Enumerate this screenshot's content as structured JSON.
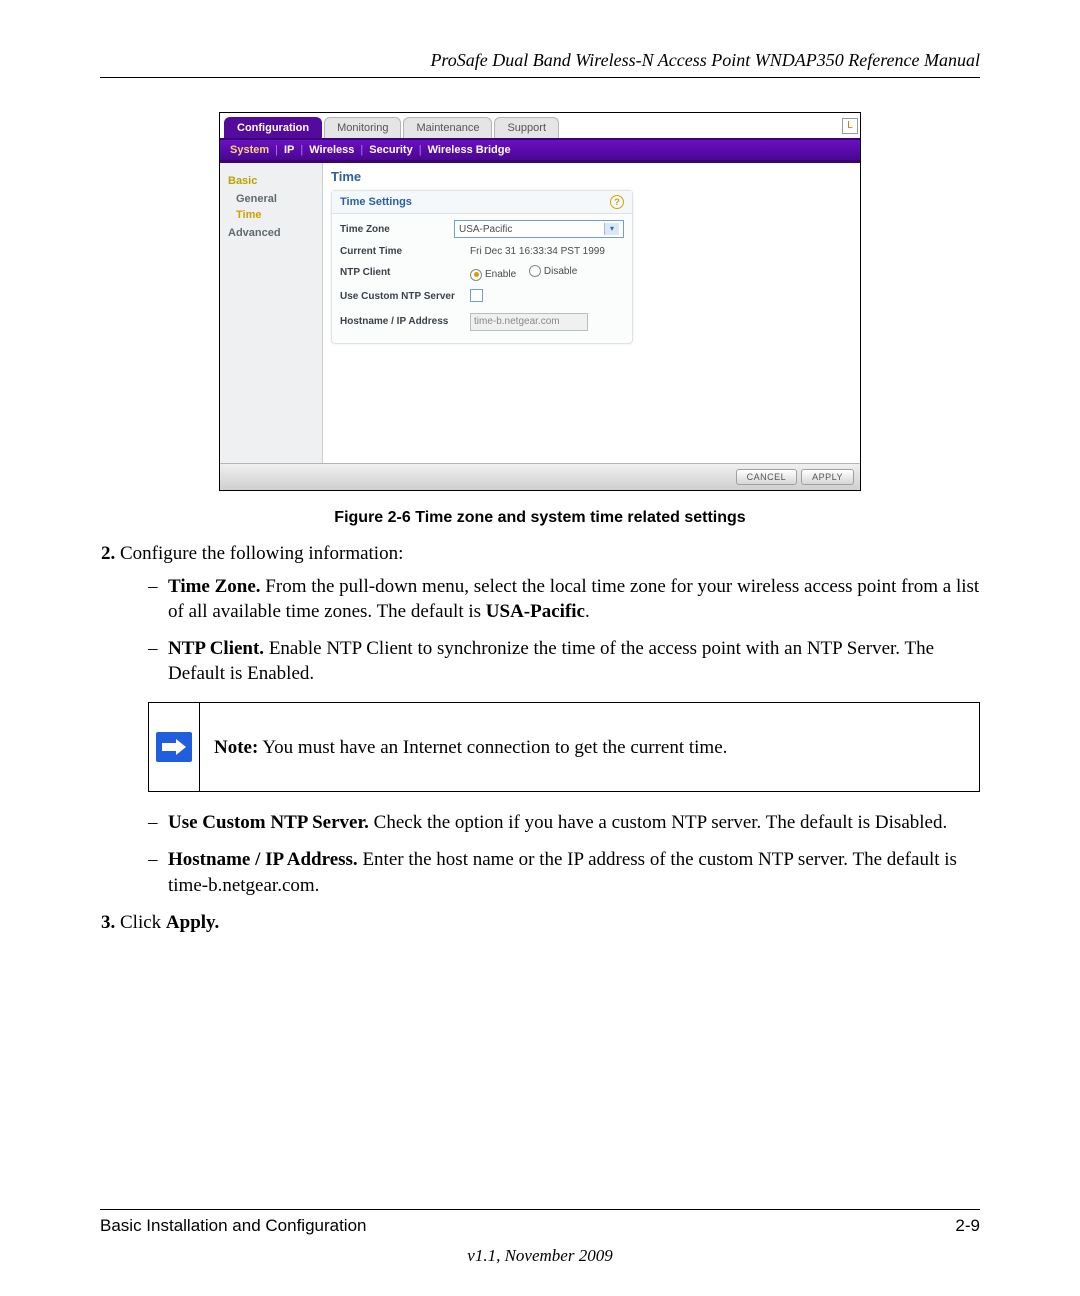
{
  "header": {
    "title": "ProSafe Dual Band Wireless-N Access Point WNDAP350 Reference Manual"
  },
  "screenshot": {
    "tabs": [
      "Configuration",
      "Monitoring",
      "Maintenance",
      "Support"
    ],
    "subnav": [
      "System",
      "IP",
      "Wireless",
      "Security",
      "Wireless Bridge"
    ],
    "sidebar": {
      "group1": "Basic",
      "items1": [
        "General",
        "Time"
      ],
      "group2": "Advanced"
    },
    "panel_title": "Time",
    "panel_subtitle": "Time Settings",
    "rows": {
      "tz_label": "Time Zone",
      "tz_value": "USA-Pacific",
      "ct_label": "Current Time",
      "ct_value": "Fri Dec 31 16:33:34 PST 1999",
      "ntp_label": "NTP Client",
      "ntp_enable": "Enable",
      "ntp_disable": "Disable",
      "custom_label": "Use Custom NTP Server",
      "host_label": "Hostname / IP Address",
      "host_value": "time-b.netgear.com"
    },
    "buttons": {
      "cancel": "CANCEL",
      "apply": "APPLY"
    }
  },
  "figure_caption": "Figure 2-6  Time zone and system time related settings",
  "step2_intro": "Configure the following information:",
  "bullets": {
    "tz_bold": "Time Zone.",
    "tz_text": " From the pull-down menu, select the local time zone for your wireless access point from a list of all available time zones. The default is ",
    "tz_def_bold": "USA-Pacific",
    "tz_after": ".",
    "ntp_bold": "NTP Client.",
    "ntp_text": " Enable NTP Client to synchronize the time of the access point with an NTP Server. The Default is Enabled.",
    "custom_bold": "Use Custom NTP Server.",
    "custom_text": " Check the option if you have a custom NTP server. The default is Disabled.",
    "host_bold": "Hostname / IP Address.",
    "host_text": " Enter the host name or the IP address of the custom NTP server. The default is time-b.netgear.com."
  },
  "note": {
    "bold": "Note:",
    "text": " You must have an Internet connection to get the current time."
  },
  "step3_pre": "Click ",
  "step3_bold": "Apply.",
  "footer": {
    "left": "Basic Installation and Configuration",
    "right": "2-9",
    "version": "v1.1, November 2009"
  }
}
